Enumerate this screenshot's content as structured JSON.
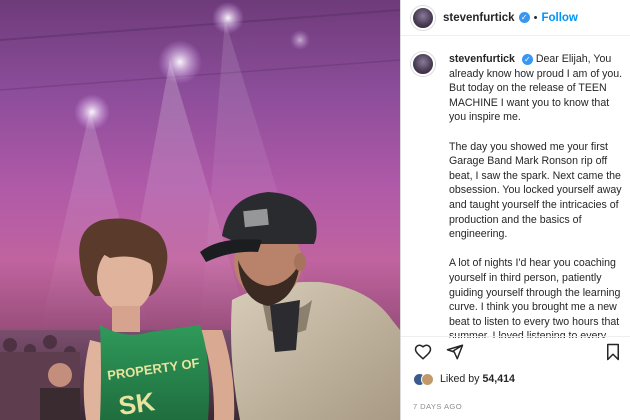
{
  "post": {
    "username": "stevenfurtick",
    "verified_icon": "verified-badge-icon",
    "follow_label": "Follow",
    "separator": "•"
  },
  "caption": {
    "username": "stevenfurtick",
    "paragraphs": [
      "Dear Elijah, You already know how proud I am of you. But today on the release of TEEN MACHINE I want you to know that you inspire me.",
      "The day you showed me your first Garage Band Mark Ronson rip off beat, I saw the spark. Next came the obsession. You locked yourself away and taught yourself the intricacies of production and the basics of engineering.",
      "A lot of nights I'd hear you coaching yourself in third person, patiently guiding yourself through the learning curve. I think you brought me a new beat to listen to every two hours that summer. I loved listening to every one, even though our tastes in music are"
    ]
  },
  "photo": {
    "shirt_text": "PROPERTY OF",
    "shirt_letters": "SK"
  },
  "actions": {
    "like_icon": "heart-icon",
    "comment_icon": "comment-icon",
    "share_icon": "share-icon",
    "save_icon": "bookmark-icon"
  },
  "likes": {
    "label": "Liked by",
    "count": "54,414"
  },
  "timestamp": "7 DAYS AGO",
  "colors": {
    "accent": "#0095f6",
    "verified": "#3897f0",
    "text": "#262626",
    "muted": "#8e8e8e"
  }
}
